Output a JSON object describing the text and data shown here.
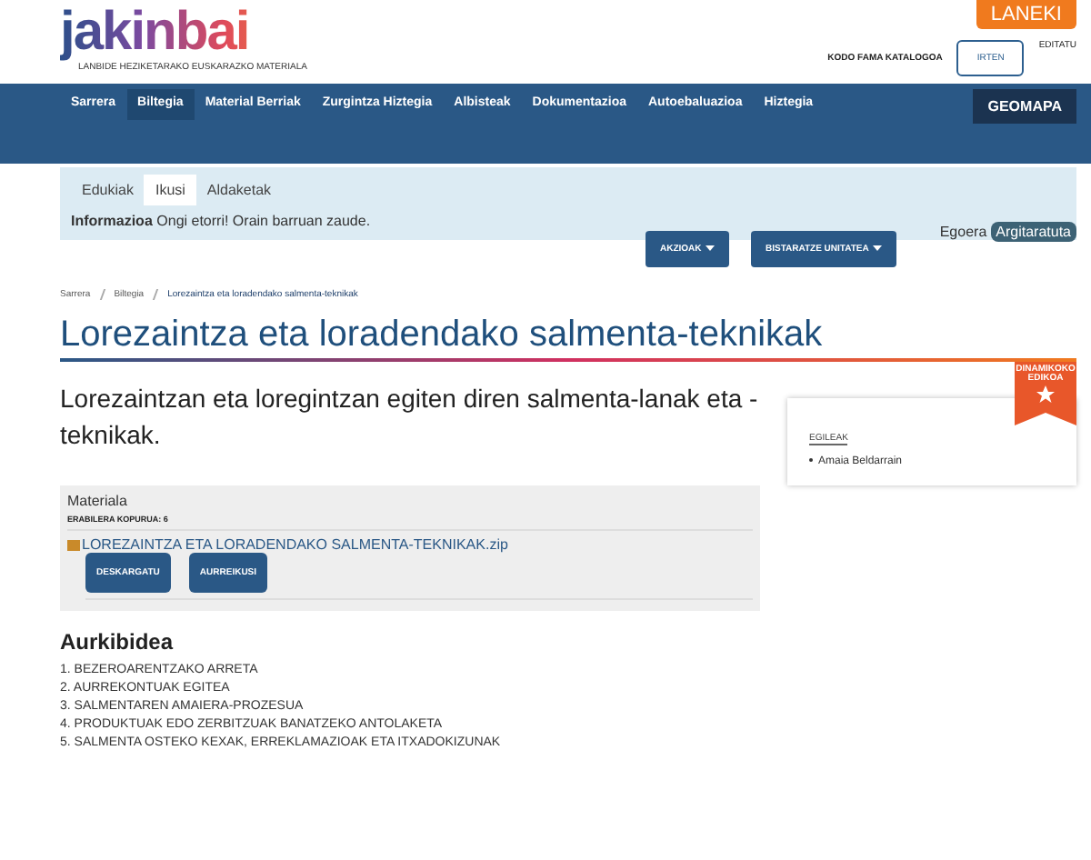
{
  "header": {
    "logo": "jakinbai",
    "tagline": "LANBIDE HEZIKETARAKO EUSKARAZKO MATERIALA",
    "brand_button": "LANEKI",
    "catalog_link": "KODO FAMA KATALOGOA",
    "logout_button": "IRTEN",
    "edit_link": "EDITATU"
  },
  "nav": {
    "items": [
      {
        "label": "Sarrera",
        "selected": false
      },
      {
        "label": "Biltegia",
        "selected": true
      },
      {
        "label": "Material Berriak",
        "selected": false
      },
      {
        "label": "Zurgintza Hiztegia",
        "selected": false
      },
      {
        "label": "Albisteak",
        "selected": false
      },
      {
        "label": "Dokumentazioa",
        "selected": false
      },
      {
        "label": "Autoebaluazioa",
        "selected": false
      },
      {
        "label": "Hiztegia",
        "selected": false
      }
    ],
    "map_button": "GEOMAPA"
  },
  "edit_panel": {
    "tabs": [
      {
        "label": "Edukiak",
        "selected": false
      },
      {
        "label": "Ikusi",
        "selected": true
      },
      {
        "label": "Aldaketak",
        "selected": false
      }
    ],
    "message_label": "Informazioa",
    "message": "Ongi etorri! Orain barruan zaude.",
    "actions_button": "AKZIOAK",
    "display_button": "BISTARATZE UNITATEA",
    "state_label": "Egoera",
    "state": "Argitaratuta"
  },
  "breadcrumb": [
    "Sarrera",
    "Biltegia",
    "Lorezaintza eta loradendako salmenta-teknikak"
  ],
  "title": "Lorezaintza eta loradendako salmenta-teknikak",
  "description": "Lorezaintzan eta loregintzan egiten diren salmenta-lanak eta -teknikak.",
  "ribbon": "DINAMIKOKO EDIKOA",
  "authors": {
    "heading": "EGILEAK",
    "names": [
      "Amaia Beldarrain"
    ]
  },
  "material": {
    "heading": "Materiala",
    "usage": "ERABILERA KOPURUA: 6",
    "file": "LOREZAINTZA ETA LORADENDAKO SALMENTA-TEKNIKAK.zip",
    "buttons": [
      "DESKARGATU",
      "AURREIKUSI"
    ]
  },
  "index": {
    "heading": "Aurkibidea",
    "items": [
      "1. BEZEROARENTZAKO ARRETA",
      "2. AURREKONTUAK EGITEA",
      "3. SALMENTAREN AMAIERA-PROZESUA",
      "4. PRODUKTUAK EDO ZERBITZUAK BANATZEKO ANTOLAKETA",
      "5. SALMENTA OSTEKO KEXAK, ERREKLAMAZIOAK ETA ITXADOKIZUNAK"
    ]
  }
}
